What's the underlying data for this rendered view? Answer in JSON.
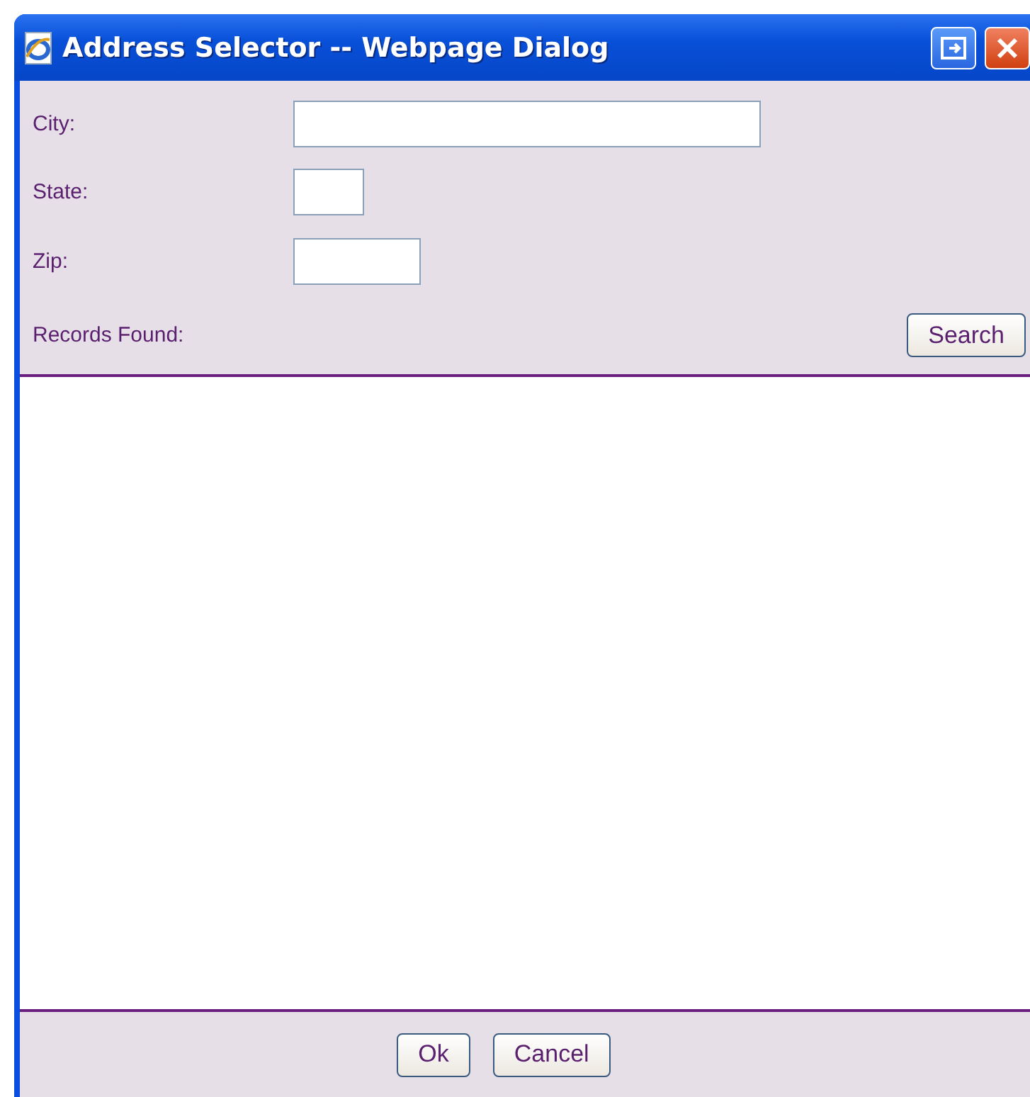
{
  "window": {
    "title": "Address Selector -- Webpage Dialog"
  },
  "fields": [
    {
      "label": "City:"
    },
    {
      "label": "State:"
    },
    {
      "label": "Zip:"
    }
  ],
  "records": {
    "label": "Records Found:",
    "search_button": "Search"
  },
  "buttons": [
    "Ok",
    "Cancel"
  ]
}
